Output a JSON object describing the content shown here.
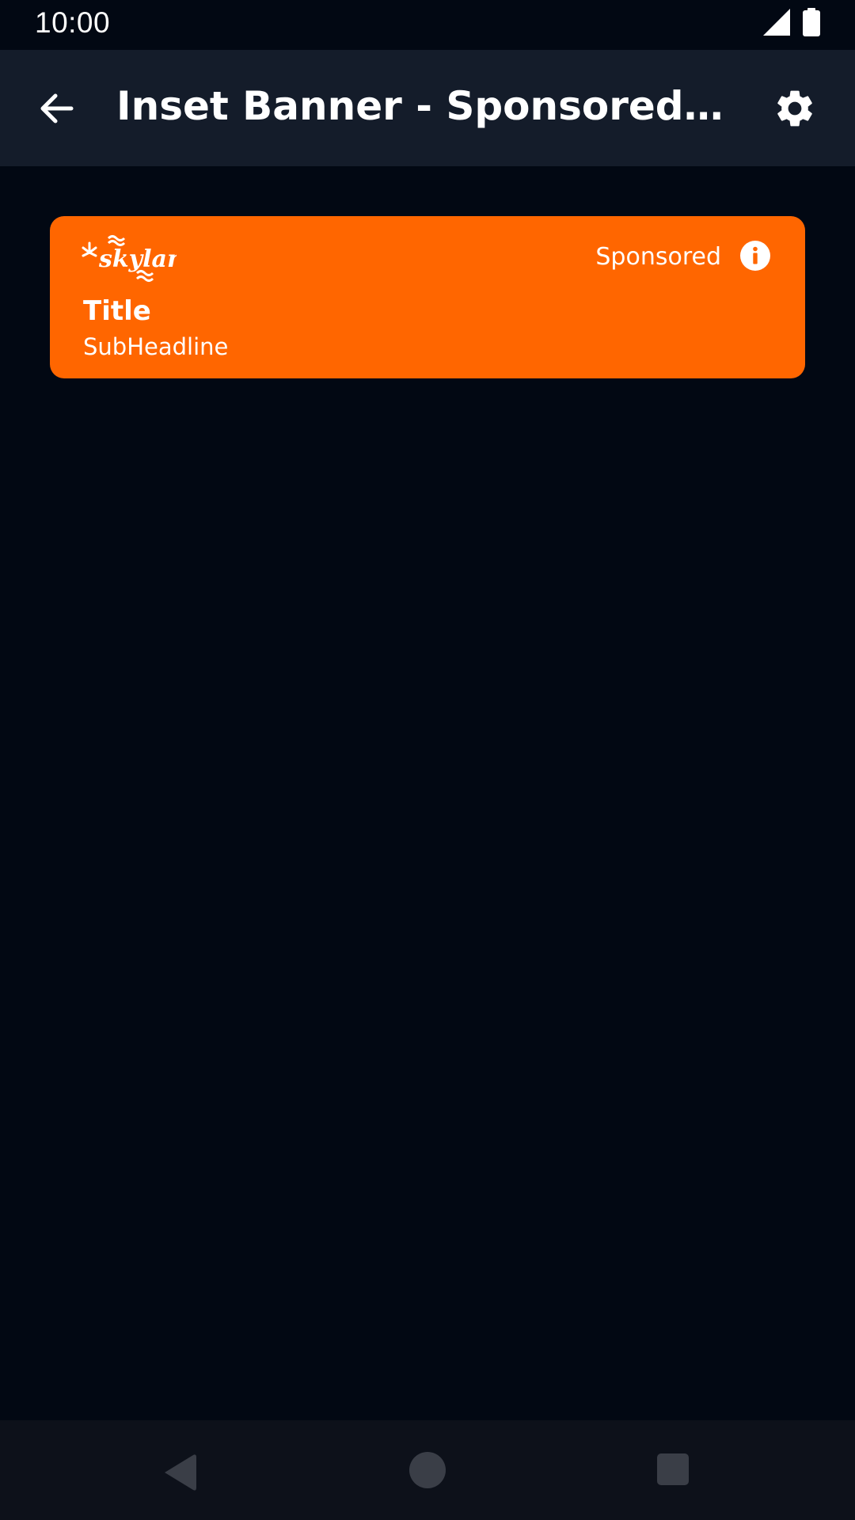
{
  "status_bar": {
    "time": "10:00",
    "icons": [
      "signal-icon",
      "battery-icon"
    ]
  },
  "app_bar": {
    "title": "Inset Banner - Sponsored OnDemand",
    "back_icon": "back-arrow-icon",
    "settings_icon": "gear-icon"
  },
  "banner": {
    "logo_text": "skyland",
    "sponsored_label": "Sponsored",
    "info_icon": "info-icon",
    "title": "Title",
    "subheadline": "SubHeadline",
    "background_color": "#ff6600"
  },
  "nav_bar": {
    "icons": [
      "nav-back-icon",
      "nav-home-icon",
      "nav-recents-icon"
    ]
  },
  "colors": {
    "background": "#020813",
    "app_bar": "#141c2a",
    "nav_bar": "#0d111a",
    "accent": "#ff6600"
  }
}
